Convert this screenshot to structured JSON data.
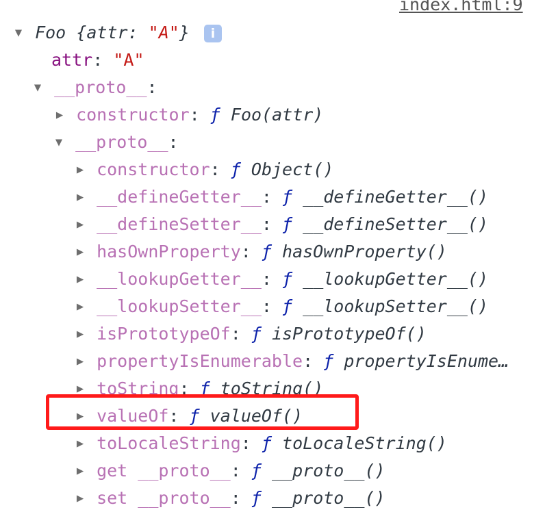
{
  "source_link": "index.html:9",
  "root": {
    "name": "Foo",
    "preview_open": "{",
    "preview_key": "attr",
    "preview_colon": ": ",
    "preview_value": "\"A\"",
    "preview_close": "}",
    "info_icon": "i"
  },
  "rows": {
    "attr": {
      "key": "attr",
      "value": "\"A\""
    },
    "proto1": {
      "key": "__proto__"
    },
    "constructor1": {
      "key": "constructor",
      "fn": "Foo(attr)"
    },
    "proto2": {
      "key": "__proto__"
    },
    "constructor2": {
      "key": "constructor",
      "fn": "Object()"
    },
    "defineGetter": {
      "key": "__defineGetter__",
      "fn": "__defineGetter__()"
    },
    "defineSetter": {
      "key": "__defineSetter__",
      "fn": "__defineSetter__()"
    },
    "hasOwnProperty": {
      "key": "hasOwnProperty",
      "fn": "hasOwnProperty()"
    },
    "lookupGetter": {
      "key": "__lookupGetter__",
      "fn": "__lookupGetter__()"
    },
    "lookupSetter": {
      "key": "__lookupSetter__",
      "fn": "__lookupSetter__()"
    },
    "isPrototypeOf": {
      "key": "isPrototypeOf",
      "fn": "isPrototypeOf()"
    },
    "propertyIsEnumerable": {
      "key": "propertyIsEnumerable",
      "fn": "propertyIsEnume…"
    },
    "toString": {
      "key": "toString",
      "fn": "toString()"
    },
    "valueOf": {
      "key": "valueOf",
      "fn": "valueOf()"
    },
    "toLocaleString": {
      "key": "toLocaleString",
      "fn": "toLocaleString()"
    },
    "getProto": {
      "key": "get __proto__",
      "fn": "__proto__()"
    },
    "setProto": {
      "key": "set __proto__",
      "fn": "__proto__()"
    }
  },
  "glyphs": {
    "expanded": "▼",
    "collapsed": "▶",
    "function_mark": "ƒ",
    "colon": ":"
  },
  "icons": {
    "expanded_arrow": "triangle-down-icon",
    "collapsed_arrow": "triangle-right-icon",
    "info": "info-icon"
  },
  "colors": {
    "own_property": "#881280",
    "proto_property": "#b871b4",
    "string_value": "#c41a16",
    "function_mark": "#0d22aa",
    "highlight": "#ff1a1a",
    "info_badge": "#aac4f0"
  }
}
